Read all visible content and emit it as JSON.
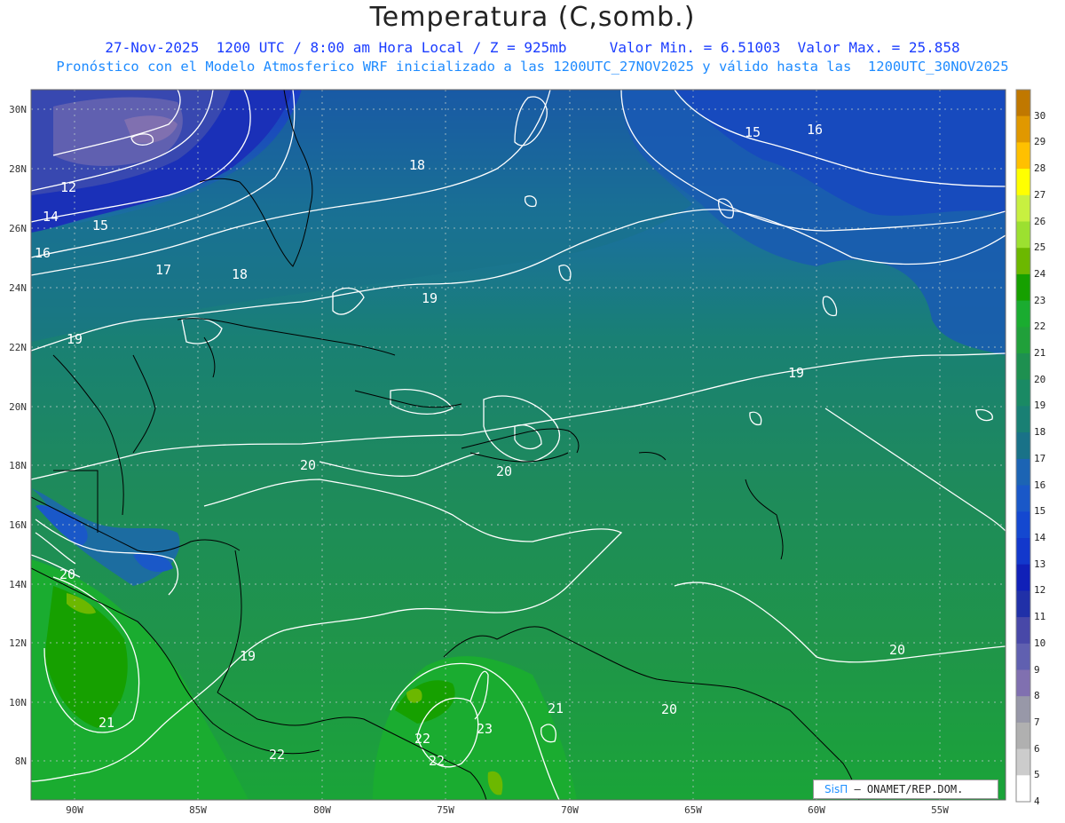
{
  "header": {
    "title": "Temperatura (C,somb.)",
    "line1": "27-Nov-2025  1200 UTC / 8:00 am Hora Local / Z = 925mb     Valor Min. = 6.51003  Valor Max. = 25.858",
    "line2": "Pronóstico con el Modelo Atmosferico WRF inicializado a las 1200UTC_27NOV2025 y válido hasta las  1200UTC_30NOV2025"
  },
  "axes": {
    "lat_ticks": [
      "30N",
      "28N",
      "26N",
      "24N",
      "22N",
      "20N",
      "18N",
      "16N",
      "14N",
      "12N",
      "10N",
      "8N"
    ],
    "lon_ticks": [
      "90W",
      "85W",
      "80W",
      "75W",
      "70W",
      "65W",
      "60W",
      "55W"
    ]
  },
  "colorbar": {
    "labels": [
      "30",
      "29",
      "28",
      "27",
      "26",
      "25",
      "24",
      "23",
      "22",
      "21",
      "20",
      "19",
      "18",
      "17",
      "16",
      "15",
      "14",
      "13",
      "12",
      "11",
      "10",
      "9",
      "8",
      "7",
      "6",
      "5",
      "4"
    ],
    "colors": [
      "#c07800",
      "#e09800",
      "#ffc000",
      "#ffff00",
      "#c8f040",
      "#9ce030",
      "#6cb800",
      "#16a000",
      "#1aac30",
      "#20a03a",
      "#1e9050",
      "#1a8a64",
      "#198074",
      "#197288",
      "#1c64b4",
      "#1a58c8",
      "#1448d0",
      "#1238cc",
      "#1020b8",
      "#2030a8",
      "#4848a8",
      "#6060b0",
      "#8070b0",
      "#9898a8",
      "#b0b0b0",
      "#cccccc",
      "#ffffff"
    ]
  },
  "contour_labels": [
    "15",
    "16",
    "18",
    "12",
    "14",
    "15",
    "16",
    "17",
    "18",
    "19",
    "19",
    "19",
    "19",
    "20",
    "20",
    "20",
    "20",
    "20",
    "21",
    "21",
    "22",
    "22",
    "22",
    "23"
  ],
  "credit": {
    "logo": "SisΠ",
    "text": "– ONAMET/REP.DOM."
  }
}
